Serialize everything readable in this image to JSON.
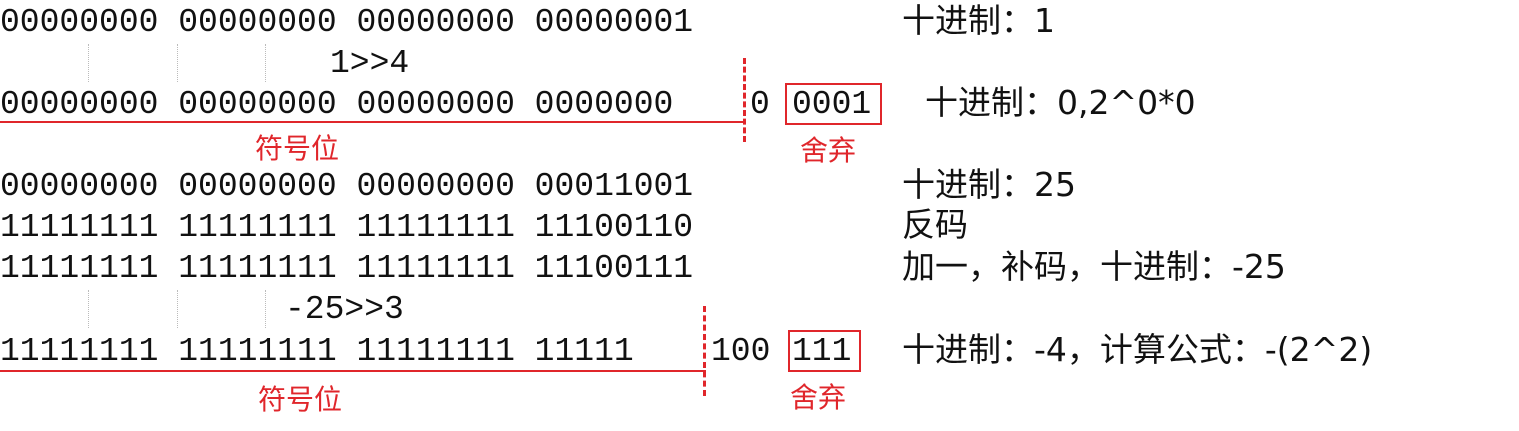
{
  "rows": {
    "r1_bits": "00000000 00000000 00000000 00000001",
    "r1_label": "十进制：1",
    "shift1": "1>>4",
    "r2_bits": "00000000 00000000 00000000 0000000",
    "r2_tail": "0",
    "r2_dropped": "0001",
    "r2_label": "十进制：0,2^0*0",
    "sign_label_1": "符号位",
    "discard_label_1": "舍弃",
    "r3_bits": "00000000 00000000 00000000 00011001",
    "r3_label": "十进制：25",
    "r4_bits": "11111111 11111111 11111111 11100110",
    "r4_label": "反码",
    "r5_bits": "11111111 11111111 11111111 11100111",
    "r5_label": "加一，补码，十进制：-25",
    "shift2": "-25>>3",
    "r6_bits": "11111111 11111111 11111111 11111",
    "r6_tail": "100",
    "r6_dropped": "111",
    "r6_label": "十进制：-4，计算公式：-(2^2)",
    "sign_label_2": "符号位",
    "discard_label_2": "舍弃"
  },
  "colors": {
    "accent": "#e0262b",
    "text": "#111111"
  }
}
